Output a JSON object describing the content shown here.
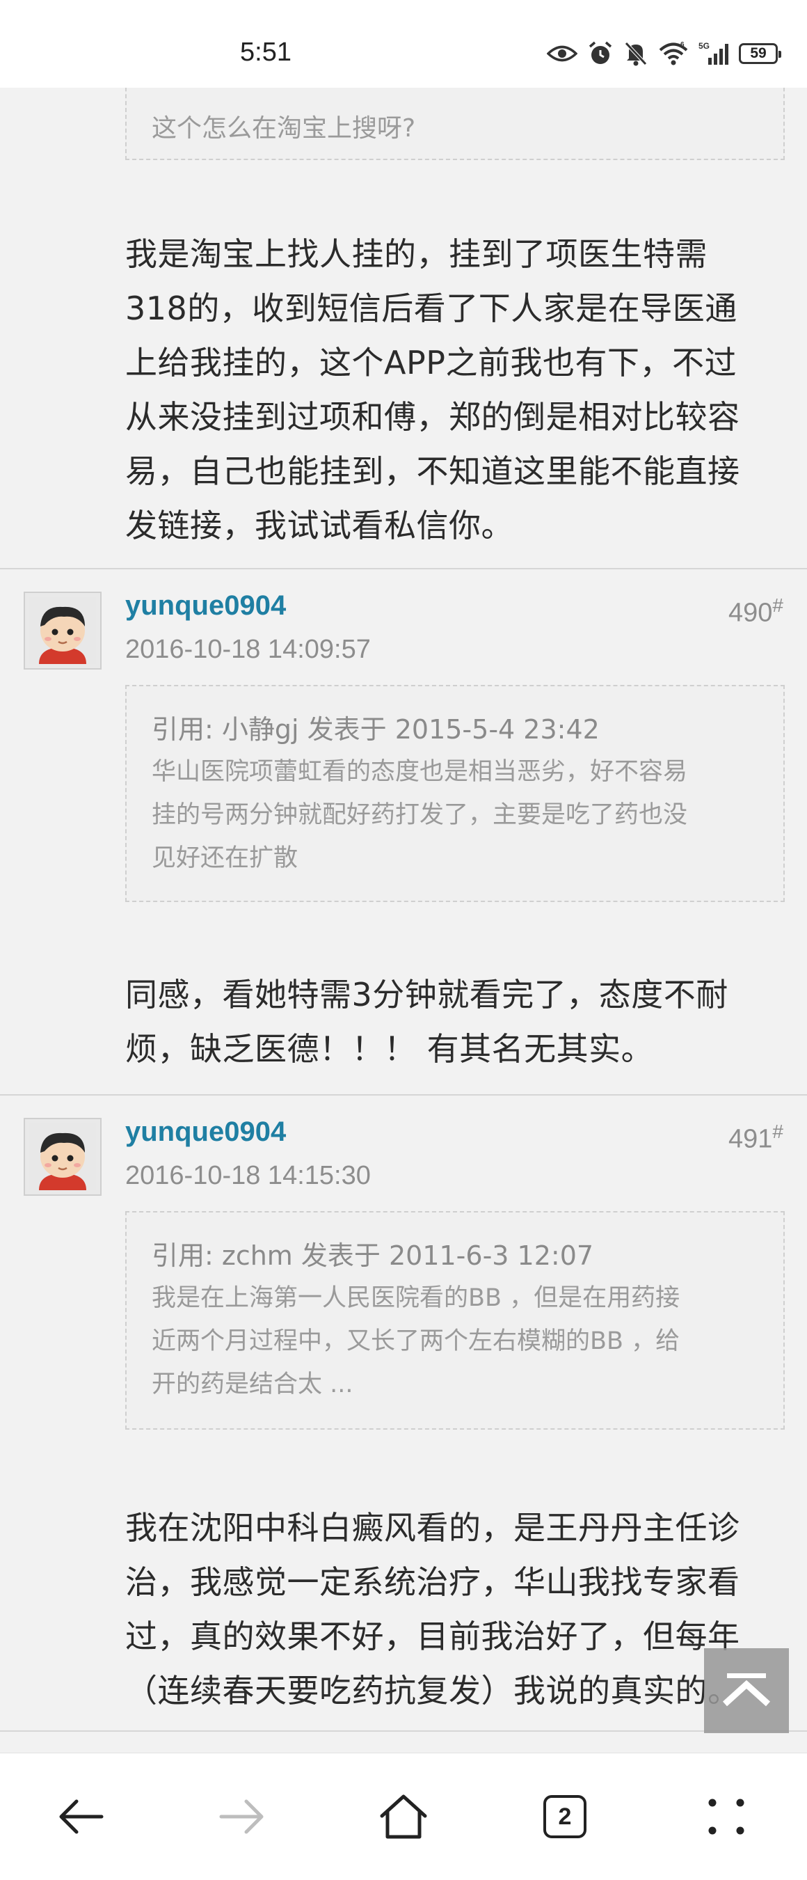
{
  "status_bar": {
    "time": "5:51",
    "battery": "59",
    "network": "5G"
  },
  "top_quote": {
    "text": "这个怎么在淘宝上搜呀?"
  },
  "first_body": {
    "lines": [
      "我是淘宝上找人挂的，挂到了项医生特需",
      "318的，收到短信后看了下人家是在导医通",
      "上给我挂的，这个APP之前我也有下，不过",
      "从来没挂到过项和傅，郑的倒是相对比较容",
      "易，自己也能挂到，不知道这里能不能直接",
      "发链接，我试试看私信你。"
    ]
  },
  "posts": [
    {
      "username": "yunque0904",
      "timestamp": "2016-10-18 14:09:57",
      "floor": "490",
      "floor_mark": "#",
      "quote_head": "引用: 小静gj 发表于 2015-5-4 23:42",
      "quote_lines": [
        "华山医院项蕾虹看的态度也是相当恶劣，好不容易",
        "挂的号两分钟就配好药打发了，主要是吃了药也没",
        "见好还在扩散"
      ],
      "body_lines": [
        "同感，看她特需3分钟就看完了，态度不耐",
        "烦，缺乏医德！！！ 有其名无其实。"
      ]
    },
    {
      "username": "yunque0904",
      "timestamp": "2016-10-18 14:15:30",
      "floor": "491",
      "floor_mark": "#",
      "quote_head": "引用: zchm 发表于 2011-6-3 12:07",
      "quote_lines": [
        "我是在上海第一人民医院看的BB ，但是在用药接",
        "近两个月过程中，又长了两个左右模糊的BB ，给",
        "开的药是结合太 ..."
      ],
      "body_lines": [
        "我在沈阳中科白癜风看的，是王丹丹主任诊",
        "治，我感觉一定系统治疗，华山我找专家看",
        "过，真的效果不好，目前我治好了，但每年",
        "（连续春天要吃药抗复发）我说的真实的。"
      ]
    }
  ],
  "bottom_nav": {
    "tab_count": "2"
  },
  "icons": [
    "eye-icon",
    "alarm-icon",
    "mute-icon",
    "wifi-icon",
    "signal-icon",
    "battery-icon",
    "back-arrow-icon",
    "forward-arrow-icon",
    "home-icon",
    "tabs-icon",
    "menu-dots-icon",
    "back-to-top-icon"
  ],
  "colors": {
    "username": "#1f7fa3",
    "background": "#f2f2f2",
    "quote_text": "#9a9a9a"
  }
}
